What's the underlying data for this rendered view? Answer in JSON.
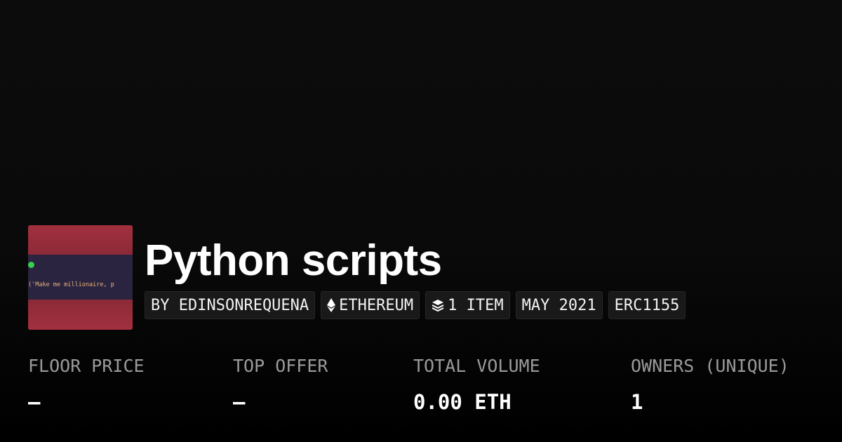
{
  "collection": {
    "title": "Python scripts",
    "thumbnail_code": "('Make me millionaire, p"
  },
  "tags": {
    "creator": "BY EDINSONREQUENA",
    "chain": "ETHEREUM",
    "chain_icon": "ethereum-icon",
    "items": "1 ITEM",
    "items_icon": "layers-icon",
    "date": "MAY 2021",
    "standard": "ERC1155"
  },
  "stats": {
    "floor_price": {
      "label": "FLOOR PRICE",
      "value": "–"
    },
    "top_offer": {
      "label": "TOP OFFER",
      "value": "–"
    },
    "total_volume": {
      "label": "TOTAL VOLUME",
      "value": "0.00 ETH"
    },
    "owners": {
      "label": "OWNERS (UNIQUE)",
      "value": "1"
    }
  },
  "colors": {
    "background": "#0b0b0b",
    "tag_background": "#191919",
    "label_gray": "#9a9a9a",
    "thumb_red": "#8e2a36",
    "thumb_band": "#2b2440"
  }
}
